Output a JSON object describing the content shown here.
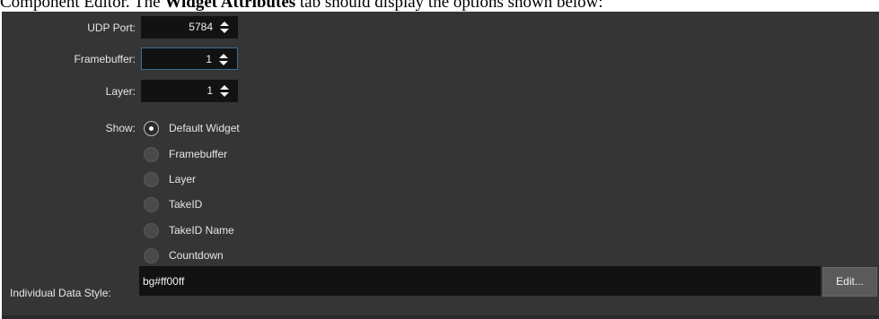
{
  "caption": {
    "prefix": "Component Editor. The ",
    "bold": "Widget Attributes",
    "suffix": " tab should display the options shown below:"
  },
  "form": {
    "udp_port": {
      "label": "UDP Port:",
      "value": "5784"
    },
    "framebuffer": {
      "label": "Framebuffer:",
      "value": "1"
    },
    "layer": {
      "label": "Layer:",
      "value": "1"
    },
    "show": {
      "label": "Show:",
      "selected": "Default Widget",
      "options": [
        "Default Widget",
        "Framebuffer",
        "Layer",
        "TakeID",
        "TakeID Name",
        "Countdown"
      ]
    },
    "individual_data_style": {
      "label": "Individual Data Style:",
      "value": "bg#ff00ff"
    },
    "edit_button_label": "Edit..."
  },
  "colors": {
    "panel_bg": "#353535",
    "field_bg": "#121212",
    "focus_border": "#3e6e8c",
    "text": "#e6e6e6"
  }
}
